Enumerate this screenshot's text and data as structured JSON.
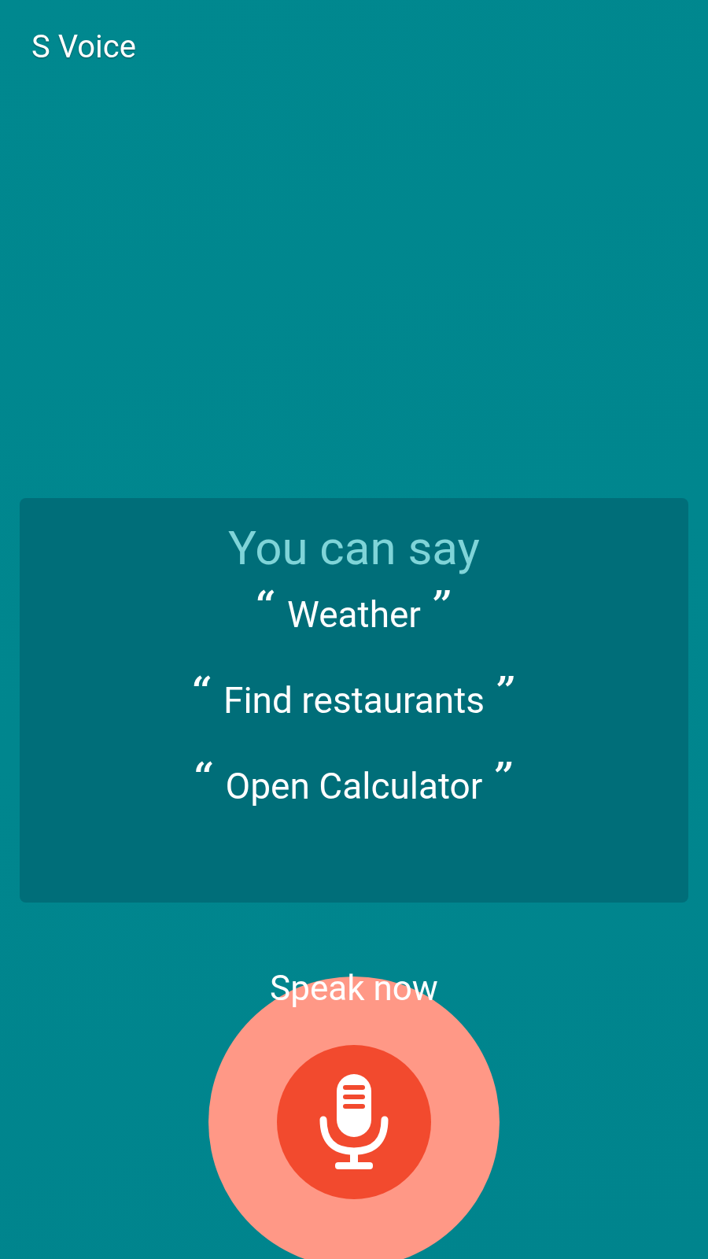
{
  "app_title": "S Voice",
  "suggestions": {
    "heading": "You can say",
    "phrases": [
      {
        "open": "“",
        "text": "Weather",
        "close": "”"
      },
      {
        "open": "“",
        "text": "Find restaurants",
        "close": "”"
      },
      {
        "open": "“",
        "text": "Open Calculator",
        "close": "”"
      }
    ]
  },
  "prompt": "Speak now"
}
